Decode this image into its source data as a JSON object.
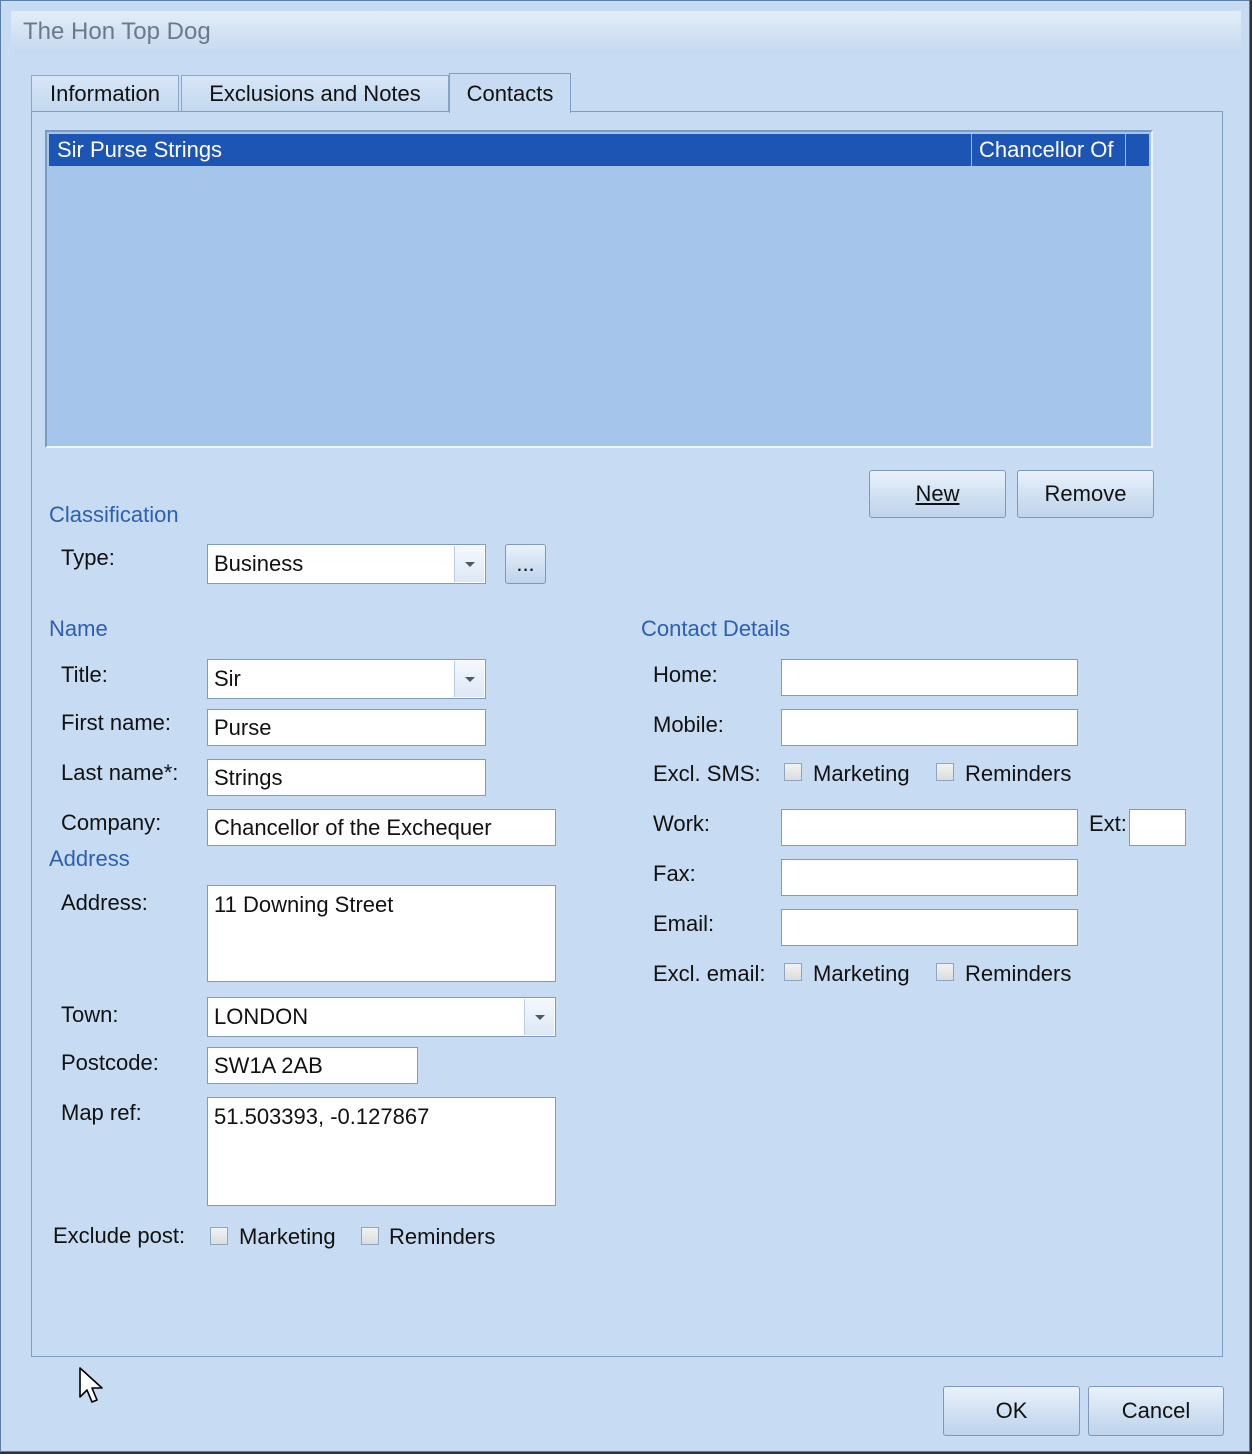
{
  "window": {
    "title": "The Hon Top Dog"
  },
  "tabs": [
    {
      "label": "Information"
    },
    {
      "label": "Exclusions and Notes"
    },
    {
      "label": "Contacts"
    }
  ],
  "contacts_list": {
    "rows": [
      {
        "name": "Sir Purse Strings",
        "role": "Chancellor Of"
      }
    ]
  },
  "list_buttons": {
    "new": "New",
    "remove": "Remove"
  },
  "classification": {
    "heading": "Classification",
    "type_label": "Type:",
    "type_value": "Business",
    "ellipsis": "..."
  },
  "name": {
    "heading": "Name",
    "title_label": "Title:",
    "title_value": "Sir",
    "first_label": "First name:",
    "first_value": "Purse",
    "last_label": "Last name*:",
    "last_value": "Strings",
    "company_label": "Company:",
    "company_value": "Chancellor of the Exchequer"
  },
  "address": {
    "heading": "Address",
    "address_label": "Address:",
    "address_value": "11 Downing Street",
    "town_label": "Town:",
    "town_value": "LONDON",
    "postcode_label": "Postcode:",
    "postcode_value": "SW1A 2AB",
    "mapref_label": "Map ref:",
    "mapref_value": "51.503393, -0.127867",
    "exclude_post_label": "Exclude post:",
    "marketing": "Marketing",
    "reminders": "Reminders"
  },
  "contact_details": {
    "heading": "Contact Details",
    "home_label": "Home:",
    "home_value": "",
    "mobile_label": "Mobile:",
    "mobile_value": "",
    "excl_sms_label": "Excl. SMS:",
    "work_label": "Work:",
    "work_value": "",
    "ext_label": "Ext:",
    "ext_value": "",
    "fax_label": "Fax:",
    "fax_value": "",
    "email_label": "Email:",
    "email_value": "",
    "excl_email_label": "Excl. email:",
    "marketing": "Marketing",
    "reminders": "Reminders"
  },
  "dialog_buttons": {
    "ok": "OK",
    "cancel": "Cancel"
  }
}
